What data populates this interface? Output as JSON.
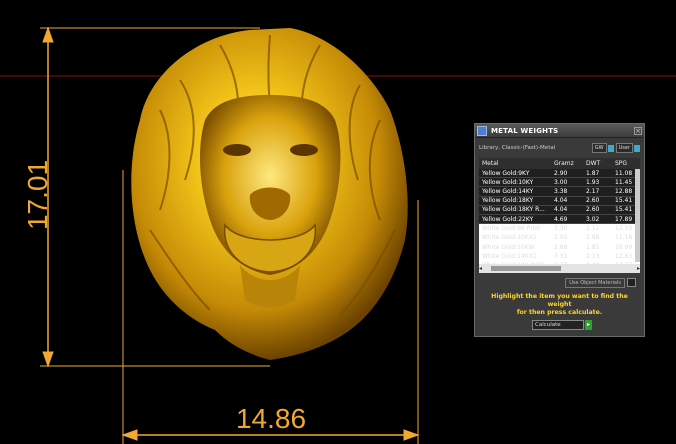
{
  "viewport": {
    "height_dimension": "17.01",
    "width_dimension": "14.86"
  },
  "panel": {
    "title": "METAL WEIGHTS",
    "close_icon": "close-icon",
    "library_label": "Library, Classic-(Fast)-Metal",
    "gw_button": "GW",
    "user_button": "User",
    "table": {
      "headers": {
        "metal": "Metal",
        "grams": "Gramz",
        "dwt": "DWT",
        "spg": "SPG"
      },
      "rows": [
        {
          "metal": "Yellow Gold:9KY",
          "grams": "2.90",
          "dwt": "1.87",
          "spg": "11.08"
        },
        {
          "metal": "Yellow Gold:10KY",
          "grams": "3.00",
          "dwt": "1.93",
          "spg": "11.45"
        },
        {
          "metal": "Yellow Gold:14KY",
          "grams": "3.38",
          "dwt": "2.17",
          "spg": "12.88"
        },
        {
          "metal": "Yellow Gold:18KY",
          "grams": "4.04",
          "dwt": "2.60",
          "spg": "15.41"
        },
        {
          "metal": "Yellow Gold:18KY R...",
          "grams": "4.04",
          "dwt": "2.60",
          "spg": "15.41"
        },
        {
          "metal": "Yellow Gold:22KY",
          "grams": "4.69",
          "dwt": "3.02",
          "spg": "17.89"
        },
        {
          "metal": "White Gold:9K PdW",
          "grams": "3.30",
          "dwt": "2.12",
          "spg": "12.59"
        },
        {
          "metal": "White Gold:10KX1",
          "grams": "2.93",
          "dwt": "1.88",
          "spg": "11.18"
        },
        {
          "metal": "White Gold:10KW",
          "grams": "2.88",
          "dwt": "1.85",
          "spg": "10.99"
        },
        {
          "metal": "White Gold:14KX1",
          "grams": "3.31",
          "dwt": "2.13",
          "spg": "12.63"
        },
        {
          "metal": "White Gold:14K PdW",
          "grams": "3.77",
          "dwt": "2.42",
          "spg": "14.37"
        }
      ]
    },
    "use_object_materials": "Use Object Materials",
    "hint_line1": "Highlight the item you want to find the weight",
    "hint_line2": "for then press calculate.",
    "calculate_label": "Calculate"
  },
  "colors": {
    "dimension": "#f0a830",
    "hint": "#ffd42a",
    "gold_light": "#ffe066",
    "gold_dark": "#8a5a00"
  }
}
